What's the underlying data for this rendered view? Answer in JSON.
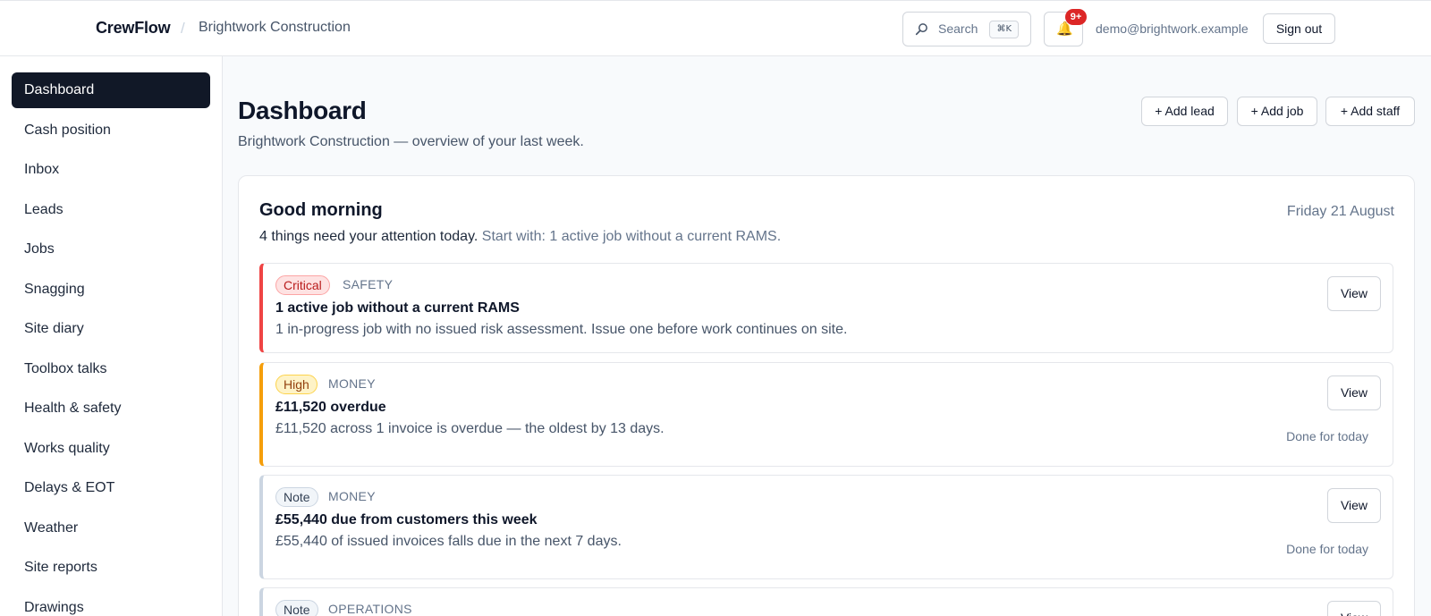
{
  "header": {
    "brand": "CrewFlow",
    "separator": "/",
    "org": "Brightwork Construction",
    "search_label": "Search",
    "search_shortcut": "⌘K",
    "notifications_count": "9+",
    "user_email": "demo@brightwork.example",
    "sign_out_label": "Sign out"
  },
  "sidebar": {
    "items": [
      {
        "label": "Dashboard",
        "active": true
      },
      {
        "label": "Cash position"
      },
      {
        "label": "Inbox"
      },
      {
        "label": "Leads"
      },
      {
        "label": "Jobs"
      },
      {
        "label": "Snagging"
      },
      {
        "label": "Site diary"
      },
      {
        "label": "Toolbox talks"
      },
      {
        "label": "Health & safety"
      },
      {
        "label": "Works quality"
      },
      {
        "label": "Delays & EOT"
      },
      {
        "label": "Weather"
      },
      {
        "label": "Site reports"
      },
      {
        "label": "Drawings"
      }
    ]
  },
  "main": {
    "title": "Dashboard",
    "subtitle": "Brightwork Construction — overview of your last week.",
    "actions": {
      "add_lead": "+ Add lead",
      "add_job": "+ Add job",
      "add_staff": "+ Add staff"
    },
    "briefing": {
      "greeting": "Good morning",
      "date": "Friday 21 August",
      "attention": "4 things need your attention today.",
      "start_with": "Start with: 1 active job without a current RAMS.",
      "alerts": [
        {
          "severity": "Critical",
          "category": "SAFETY",
          "title": "1 active job without a current RAMS",
          "description": "1 in-progress job with no issued risk assessment. Issue one before work continues on site.",
          "view_label": "View"
        },
        {
          "severity": "High",
          "category": "MONEY",
          "title": "£11,520 overdue",
          "description": "£11,520 across 1 invoice is overdue — the oldest by 13 days.",
          "view_label": "View",
          "done_label": "Done for today"
        },
        {
          "severity": "Note",
          "category": "MONEY",
          "title": "£55,440 due from customers this week",
          "description": "£55,440 of issued invoices falls due in the next 7 days.",
          "view_label": "View",
          "done_label": "Done for today"
        },
        {
          "severity": "Note",
          "category": "OPERATIONS",
          "view_label": "View"
        }
      ]
    }
  }
}
